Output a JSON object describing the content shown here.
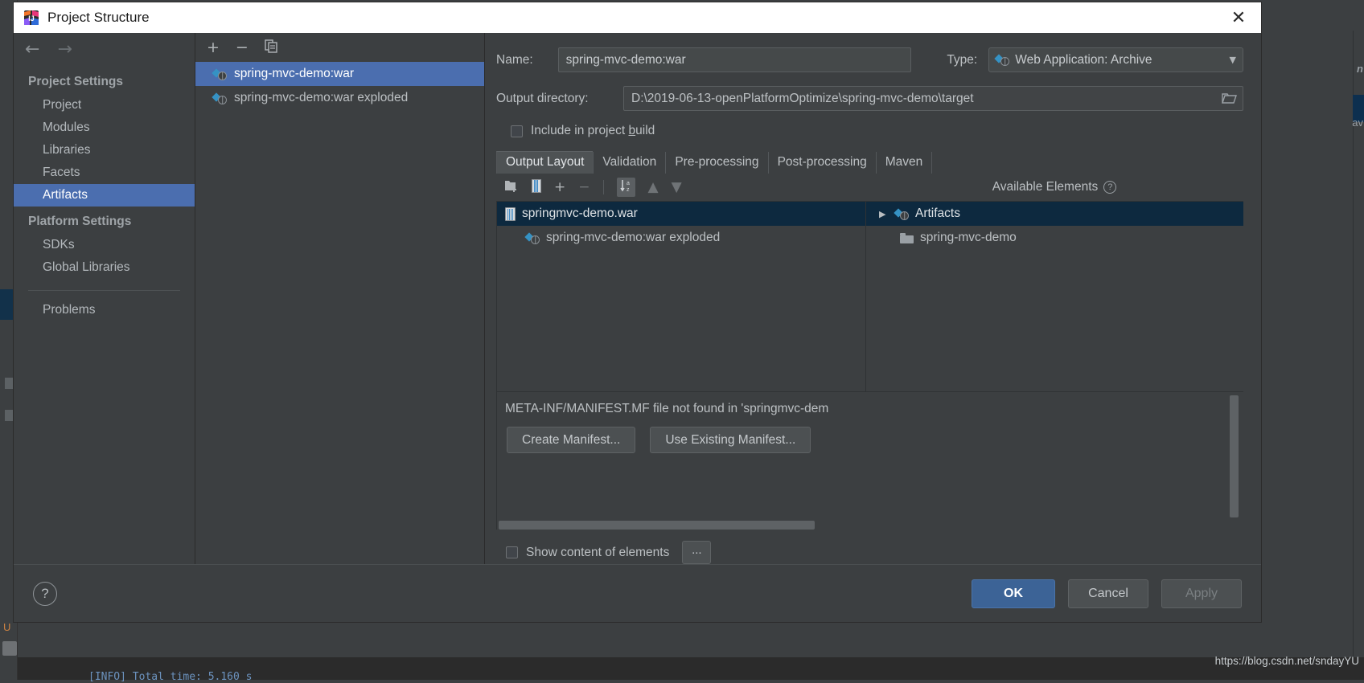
{
  "window": {
    "title": "Project Structure",
    "app_icon": "intellij-idea-logo",
    "close_icon": "✕"
  },
  "nav": {
    "back_icon": "←",
    "forward_icon": "→"
  },
  "sidebar": {
    "groups": [
      {
        "label": "Project Settings",
        "items": [
          {
            "label": "Project",
            "selected": false
          },
          {
            "label": "Modules",
            "selected": false
          },
          {
            "label": "Libraries",
            "selected": false
          },
          {
            "label": "Facets",
            "selected": false
          },
          {
            "label": "Artifacts",
            "selected": true
          }
        ]
      },
      {
        "label": "Platform Settings",
        "items": [
          {
            "label": "SDKs",
            "selected": false
          },
          {
            "label": "Global Libraries",
            "selected": false
          }
        ]
      }
    ],
    "extra": [
      {
        "label": "Problems",
        "selected": false
      }
    ]
  },
  "artifacts_panel": {
    "toolbar": {
      "add": "+",
      "remove": "−",
      "copy": "copy-icon"
    },
    "items": [
      {
        "label": "spring-mvc-demo:war",
        "selected": true
      },
      {
        "label": "spring-mvc-demo:war exploded",
        "selected": false
      }
    ]
  },
  "details": {
    "name_label": "Name:",
    "name_value": "spring-mvc-demo:war",
    "type_label": "Type:",
    "type_value": "Web Application: Archive",
    "output_label": "Output directory:",
    "output_value": "D:\\2019-06-13-openPlatformOptimize\\spring-mvc-demo\\target",
    "include_build_label_pre": "Include in project ",
    "include_build_label_accel": "b",
    "include_build_label_post": "uild",
    "include_build_checked": false,
    "tabs": [
      {
        "label": "Output Layout",
        "active": true
      },
      {
        "label": "Validation",
        "active": false
      },
      {
        "label": "Pre-processing",
        "active": false
      },
      {
        "label": "Post-processing",
        "active": false
      },
      {
        "label": "Maven",
        "active": false
      }
    ],
    "layout_toolbar": {
      "add_directory": "add-directory-icon",
      "add_archive": "add-archive-icon",
      "add_element": "+",
      "remove_element": "−",
      "sort": "sort-az-icon",
      "move_up": "▲",
      "move_down": "▼"
    },
    "available_elements_label": "Available Elements",
    "help_glyph": "?",
    "output_tree": [
      {
        "label": "springmvc-demo.war",
        "icon": "jar-icon",
        "selected": true,
        "indent": 0
      },
      {
        "label": "spring-mvc-demo:war exploded",
        "icon": "artifact-icon",
        "selected": false,
        "indent": 1
      }
    ],
    "available_tree": [
      {
        "label": "Artifacts",
        "icon": "artifact-icon",
        "twisty": "▶",
        "selected": true,
        "indent": 0
      },
      {
        "label": "spring-mvc-demo",
        "icon": "folder-icon",
        "twisty": "",
        "selected": false,
        "indent": 1
      }
    ],
    "manifest_message": "META-INF/MANIFEST.MF file not found in 'springmvc-dem",
    "create_manifest_label": "Create Manifest...",
    "use_existing_manifest_label": "Use Existing Manifest...",
    "show_content_label": "Show content of elements",
    "show_content_checked": false,
    "dots_label": "..."
  },
  "footer": {
    "help_glyph": "?",
    "ok_label": "OK",
    "cancel_label": "Cancel",
    "apply_label": "Apply"
  },
  "background": {
    "console_line": "[INFO] Total time:  5.160 s",
    "right_edge_text_1": "n",
    "right_edge_text_2": "av",
    "left_u": "U"
  },
  "watermark": "https://blog.csdn.net/sndayYU",
  "colors": {
    "accent_blue": "#4b6eaf",
    "selection_navy": "#0d293f",
    "panel_bg": "#3c3f41",
    "ok_blue": "#3c6396",
    "icon_cyan": "#3592c4"
  }
}
